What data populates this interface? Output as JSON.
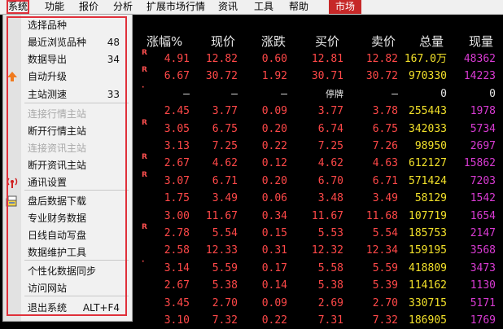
{
  "menubar": {
    "items": [
      "系统",
      "功能",
      "报价",
      "分析",
      "扩展市场行情",
      "资讯",
      "工具",
      "帮助"
    ],
    "market_button": "市场"
  },
  "table": {
    "headers": [
      "涨幅%",
      "现价",
      "涨跌",
      "买价",
      "卖价",
      "总量",
      "现量"
    ],
    "rows": [
      {
        "flag": "R",
        "change_pct": "4.91",
        "price": "12.82",
        "change": "0.60",
        "bid": "12.81",
        "ask": "12.82",
        "volume": "167.0万",
        "current_volume": "48362"
      },
      {
        "flag": "R",
        "change_pct": "6.67",
        "price": "30.72",
        "change": "1.92",
        "bid": "30.71",
        "ask": "30.72",
        "volume": "970330",
        "current_volume": "14223"
      },
      {
        "flag": "·",
        "change_pct": "—",
        "price": "—",
        "change": "—",
        "bid": "停牌",
        "ask": "—",
        "volume": "0",
        "current_volume": "0"
      },
      {
        "flag": "",
        "change_pct": "2.45",
        "price": "3.77",
        "change": "0.09",
        "bid": "3.77",
        "ask": "3.78",
        "volume": "255443",
        "current_volume": "1978"
      },
      {
        "flag": "R",
        "change_pct": "3.05",
        "price": "6.75",
        "change": "0.20",
        "bid": "6.74",
        "ask": "6.75",
        "volume": "342033",
        "current_volume": "5734"
      },
      {
        "flag": "",
        "change_pct": "3.13",
        "price": "7.25",
        "change": "0.22",
        "bid": "7.25",
        "ask": "7.26",
        "volume": "98950",
        "current_volume": "2697"
      },
      {
        "flag": "R",
        "change_pct": "2.67",
        "price": "4.62",
        "change": "0.12",
        "bid": "4.62",
        "ask": "4.63",
        "volume": "612127",
        "current_volume": "15862"
      },
      {
        "flag": "R",
        "change_pct": "3.07",
        "price": "6.71",
        "change": "0.20",
        "bid": "6.70",
        "ask": "6.71",
        "volume": "571424",
        "current_volume": "7203"
      },
      {
        "flag": "",
        "change_pct": "1.75",
        "price": "3.49",
        "change": "0.06",
        "bid": "3.48",
        "ask": "3.49",
        "volume": "58129",
        "current_volume": "1542"
      },
      {
        "flag": "",
        "change_pct": "3.00",
        "price": "11.67",
        "change": "0.34",
        "bid": "11.67",
        "ask": "11.68",
        "volume": "107719",
        "current_volume": "1654"
      },
      {
        "flag": "R",
        "change_pct": "2.78",
        "price": "5.54",
        "change": "0.15",
        "bid": "5.53",
        "ask": "5.54",
        "volume": "185753",
        "current_volume": "2147"
      },
      {
        "flag": "",
        "change_pct": "2.58",
        "price": "12.33",
        "change": "0.31",
        "bid": "12.32",
        "ask": "12.34",
        "volume": "159195",
        "current_volume": "3568"
      },
      {
        "flag": "·",
        "change_pct": "3.14",
        "price": "5.59",
        "change": "0.17",
        "bid": "5.58",
        "ask": "5.59",
        "volume": "418809",
        "current_volume": "3473"
      },
      {
        "flag": "",
        "change_pct": "2.67",
        "price": "5.38",
        "change": "0.14",
        "bid": "5.38",
        "ask": "5.39",
        "volume": "114162",
        "current_volume": "1130"
      },
      {
        "flag": "",
        "change_pct": "3.45",
        "price": "2.70",
        "change": "0.09",
        "bid": "2.69",
        "ask": "2.70",
        "volume": "330715",
        "current_volume": "5171"
      },
      {
        "flag": "",
        "change_pct": "3.10",
        "price": "7.32",
        "change": "0.22",
        "bid": "7.31",
        "ask": "7.32",
        "volume": "186905",
        "current_volume": "1769"
      }
    ]
  },
  "menu": {
    "items": [
      {
        "label": "选择品种",
        "shortcut": "",
        "disabled": false
      },
      {
        "label": "最近浏览品种",
        "shortcut": "48",
        "disabled": false
      },
      {
        "label": "数据导出",
        "shortcut": "34",
        "disabled": false
      },
      {
        "label": "自动升级",
        "shortcut": "",
        "disabled": false
      },
      {
        "label": "主站测速",
        "shortcut": "33",
        "disabled": false
      },
      {
        "label": "连接行情主站",
        "shortcut": "",
        "disabled": true
      },
      {
        "label": "断开行情主站",
        "shortcut": "",
        "disabled": false
      },
      {
        "label": "连接资讯主站",
        "shortcut": "",
        "disabled": true
      },
      {
        "label": "断开资讯主站",
        "shortcut": "",
        "disabled": false
      },
      {
        "label": "通讯设置",
        "shortcut": "",
        "disabled": false
      },
      {
        "label": "盘后数据下载",
        "shortcut": "",
        "disabled": false
      },
      {
        "label": "专业财务数据",
        "shortcut": "",
        "disabled": false
      },
      {
        "label": "日线自动写盘",
        "shortcut": "",
        "disabled": false
      },
      {
        "label": "数据维护工具",
        "shortcut": "",
        "disabled": false
      },
      {
        "label": "个性化数据同步",
        "shortcut": "",
        "disabled": false
      },
      {
        "label": "访问网站",
        "shortcut": "",
        "disabled": false
      },
      {
        "label": "退出系统",
        "shortcut": "ALT+F4",
        "disabled": false
      }
    ]
  },
  "colors": {
    "background": "#000000",
    "up": "#ff4848",
    "volume": "#f2e02a",
    "current_volume": "#d93bd3",
    "highlight_frame": "#e0303a"
  }
}
